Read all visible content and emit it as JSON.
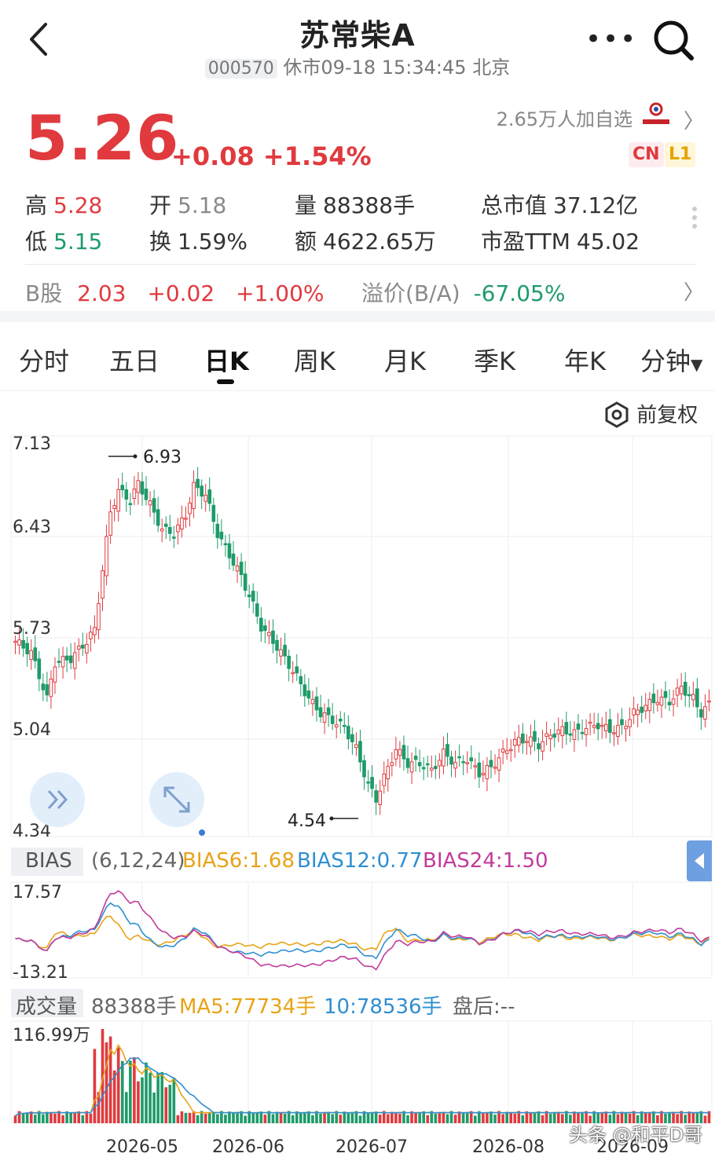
{
  "header": {
    "title": "苏常柴A",
    "code": "000570",
    "status_time": "休市09-18 15:34:45 北京",
    "more_icon": "more-dots-icon",
    "search_icon": "search-icon",
    "back_icon": "back-chevron-icon"
  },
  "quote": {
    "price": "5.26",
    "change": "+0.08",
    "change_pct": "+1.54%",
    "watchers": "2.65万人加自选",
    "badge_cn": "CN",
    "badge_l1": "L1",
    "stats": {
      "high_label": "高",
      "high": "5.28",
      "open_label": "开",
      "open": "5.18",
      "vol_label": "量",
      "vol": "88388手",
      "mcap_label": "总市值",
      "mcap": "37.12亿",
      "low_label": "低",
      "low": "5.15",
      "turnover_label": "换",
      "turnover": "1.59%",
      "amount_label": "额",
      "amount": "4622.65万",
      "pe_label": "市盈TTM",
      "pe": "45.02"
    },
    "bshare": {
      "label": "B股",
      "price": "2.03",
      "change": "+0.02",
      "pct": "+1.00%",
      "premium_label": "溢价(B/A)",
      "premium": "-67.05%"
    }
  },
  "tabs": [
    "分时",
    "五日",
    "日K",
    "周K",
    "月K",
    "季K",
    "年K",
    "分钟"
  ],
  "active_tab": "日K",
  "fuquan": "前复权",
  "kline": {
    "y_labels": [
      "7.13",
      "6.43",
      "5.73",
      "5.04",
      "4.34"
    ],
    "max_label": "6.93",
    "min_label": "4.54",
    "x_labels": [
      "2026-05",
      "2026-06",
      "2026-07",
      "2026-08",
      "2026-09"
    ]
  },
  "bias": {
    "name": "BIAS",
    "params": "(6,12,24)",
    "b6": "BIAS6:1.68",
    "b12": "BIAS12:0.77",
    "b24": "BIAS24:1.50",
    "ytop": "17.57",
    "ybot": "-13.21"
  },
  "volume": {
    "name": "成交量",
    "vol": "88388手",
    "ma5": "MA5:77734手",
    "ma10": "10:78536手",
    "after": "盘后:--",
    "ytop": "116.99万"
  },
  "colors": {
    "up": "#e03a3e",
    "down": "#1e9b6a",
    "ma5": "#e8a317",
    "ma10": "#2f8fd1",
    "bias24": "#c23b9a"
  },
  "watermark": "头条 @和平D哥"
}
